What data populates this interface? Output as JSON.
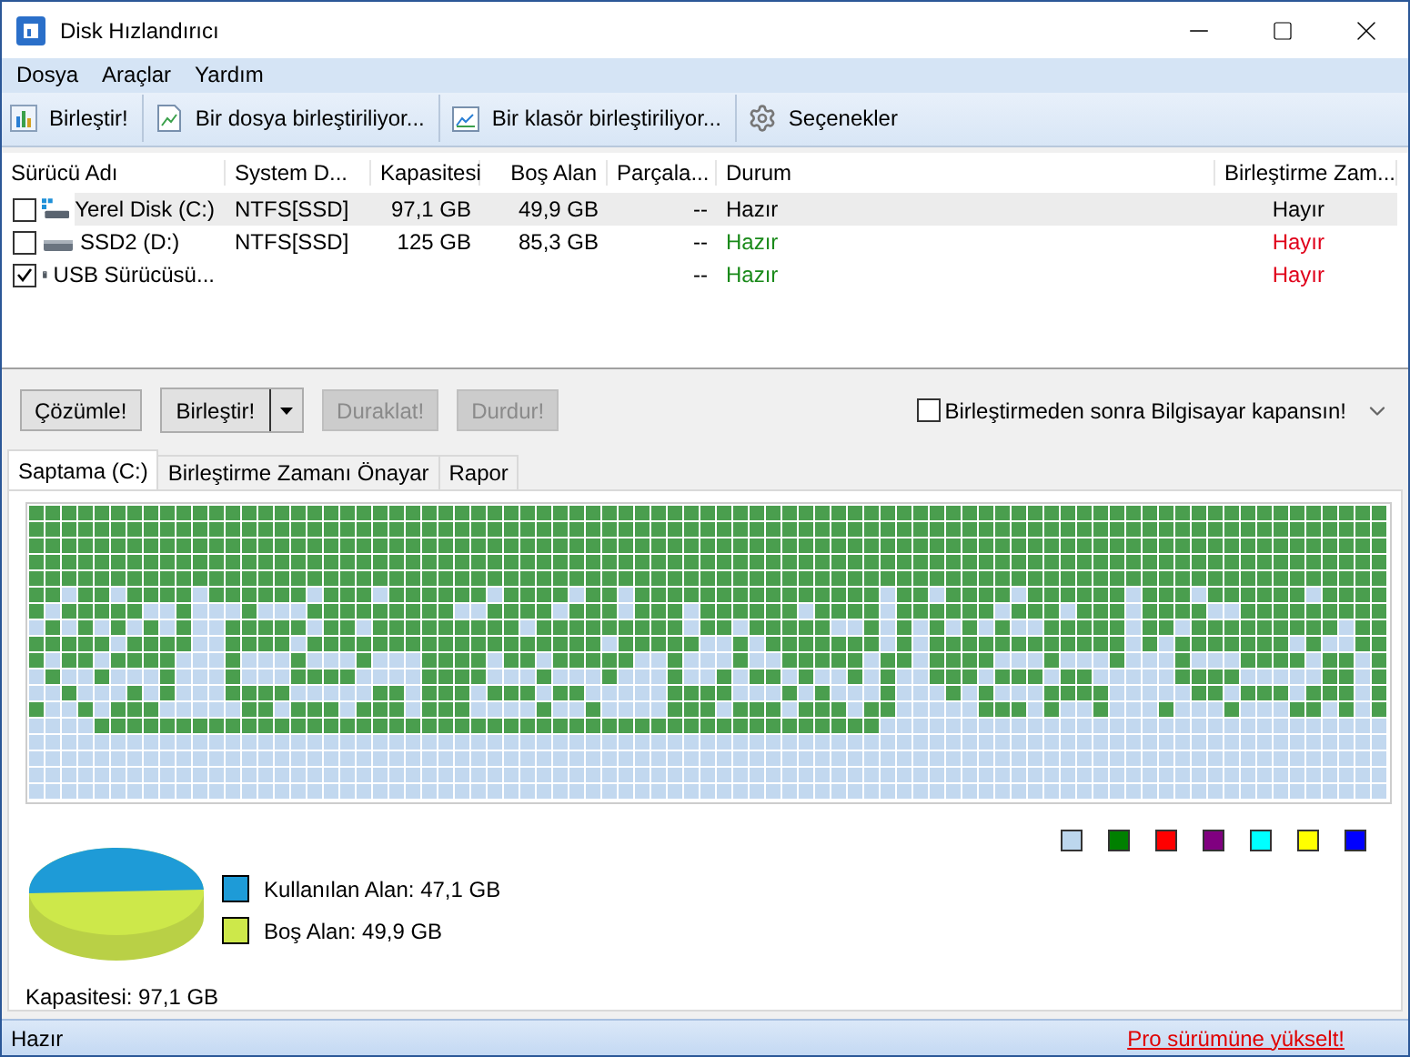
{
  "window": {
    "title": "Disk Hızlandırıcı"
  },
  "menu": [
    "Dosya",
    "Araçlar",
    "Yardım"
  ],
  "toolbar": [
    {
      "kind": "chart",
      "label": "Birleştir!"
    },
    {
      "kind": "file",
      "label": "Bir dosya birleştiriliyor..."
    },
    {
      "kind": "folder",
      "label": "Bir klasör birleştiriliyor..."
    },
    {
      "kind": "gear",
      "label": "Seçenekler"
    }
  ],
  "table": {
    "columns": [
      "Sürücü Adı",
      "System D...",
      "Kapasitesi",
      "Boş Alan",
      "Parçala...",
      "Durum",
      "Birleştirme Zam..."
    ],
    "rows": [
      {
        "kind": "system",
        "selected": true,
        "checked": false,
        "name": "Yerel Disk (C:)",
        "fs": "NTFS[SSD]",
        "capacity": "97,1 GB",
        "free": "49,9 GB",
        "fragmented": "--",
        "status": "Hazır",
        "scheduled": "Hayır"
      },
      {
        "kind": "disk",
        "selected": false,
        "checked": false,
        "name": "SSD2 (D:)",
        "fs": "NTFS[SSD]",
        "capacity": "125 GB",
        "free": "85,3 GB",
        "fragmented": "--",
        "status": "Hazır",
        "scheduled": "Hayır"
      },
      {
        "kind": "usb",
        "selected": false,
        "checked": true,
        "name": "USB Sürücüsü...",
        "fragmented": "--",
        "status": "Hazır",
        "scheduled": "Hayır"
      }
    ]
  },
  "actions": [
    {
      "kind": "plain",
      "label": "Çözümle!",
      "disabled": false
    },
    {
      "kind": "split",
      "label": "Birleştir!",
      "disabled": false
    },
    {
      "kind": "plain",
      "label": "Duraklat!",
      "disabled": true
    },
    {
      "kind": "plain",
      "label": "Durdur!",
      "disabled": true
    }
  ],
  "shutdown": {
    "label": "Birleştirmeden sonra Bilgisayar kapansın!",
    "checked": false
  },
  "tabs": [
    {
      "label": "Saptama (C:)",
      "selected": true
    },
    {
      "label": "Birleştirme Zamanı Önayar",
      "selected": false
    },
    {
      "label": "Rapor",
      "selected": false
    }
  ],
  "legend": [
    {
      "color": "#bdd7ee"
    },
    {
      "color": "#008000"
    },
    {
      "color": "#ff0000"
    },
    {
      "color": "#800080"
    },
    {
      "color": "#00ffff"
    },
    {
      "color": "#ffff00"
    },
    {
      "color": "#0000ff"
    }
  ],
  "usage": {
    "items": [
      {
        "label": "Kullanılan Alan: 47,1 GB",
        "color": "#1e9bd7"
      },
      {
        "label": "Boş Alan: 49,9 GB",
        "color": "#cde84a"
      }
    ],
    "capacity": "Kapasitesi: 97,1 GB"
  },
  "status_bar": {
    "text": "Hazır",
    "link": "Pro sürümüne yükselt!"
  }
}
